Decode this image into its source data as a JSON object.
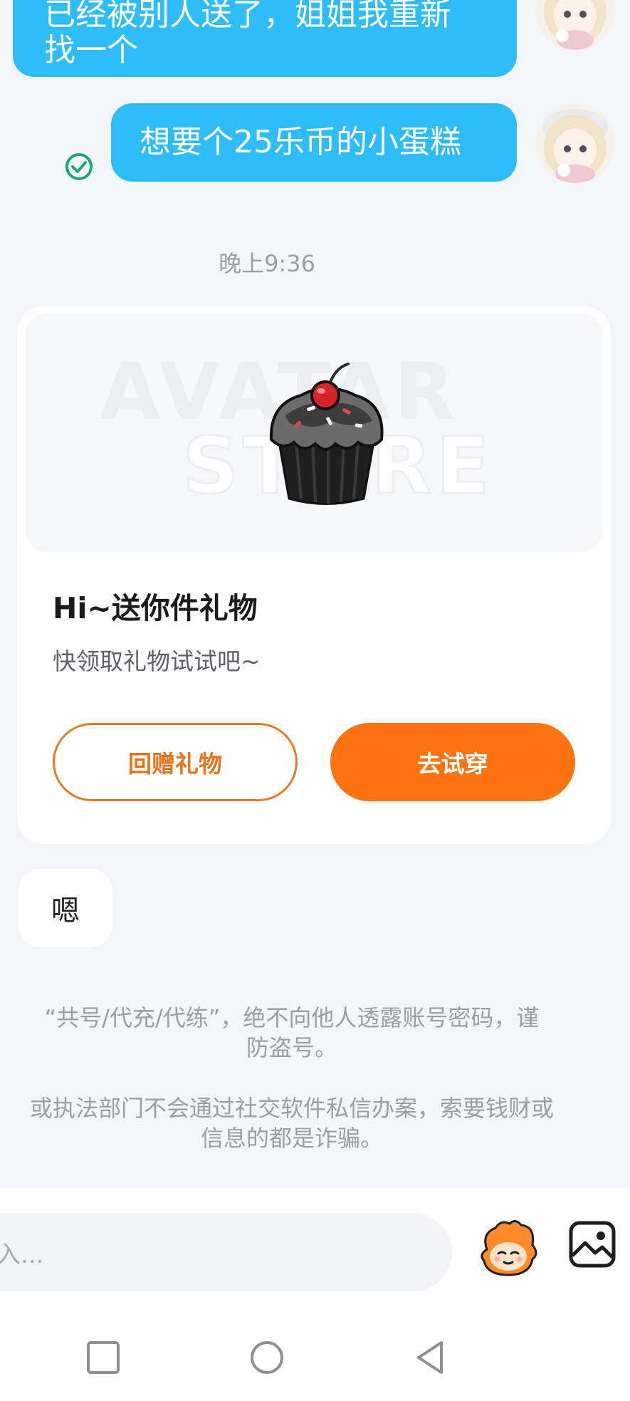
{
  "messages": {
    "previous_out": "已经被别人送了，姐姐我重新\n找一个",
    "cake_request": "想要个25乐币的小蛋糕",
    "timestamp": "晚上9:36",
    "reply_in": "嗯"
  },
  "gift_card": {
    "watermark_line1": "AVATAR",
    "watermark_line2": "STORE",
    "title": "Hi~送你件礼物",
    "subtitle": "快领取礼物试试吧~",
    "return_gift_label": "回赠礼物",
    "try_on_label": "去试穿"
  },
  "notices": {
    "account_safety": "“共号/代充/代练”，绝不向他人透露账号密码，谨\n防盗号。",
    "fraud_warning": "或执法部门不会通过社交软件私信办案，索要钱财或\n信息的都是诈骗。"
  },
  "composer": {
    "placeholder": "入..."
  },
  "colors": {
    "outgoing_bubble": "#2ebcfb",
    "primary_button": "#ff7411",
    "secondary_button_border": "#e27b2a",
    "read_check": "#1fa57a"
  },
  "icons": {
    "read_receipt": "check-circle-icon",
    "sticker": "mascot-sticker-icon",
    "image": "image-icon",
    "nav_recent": "square-icon",
    "nav_home": "circle-icon",
    "nav_back": "triangle-back-icon"
  }
}
